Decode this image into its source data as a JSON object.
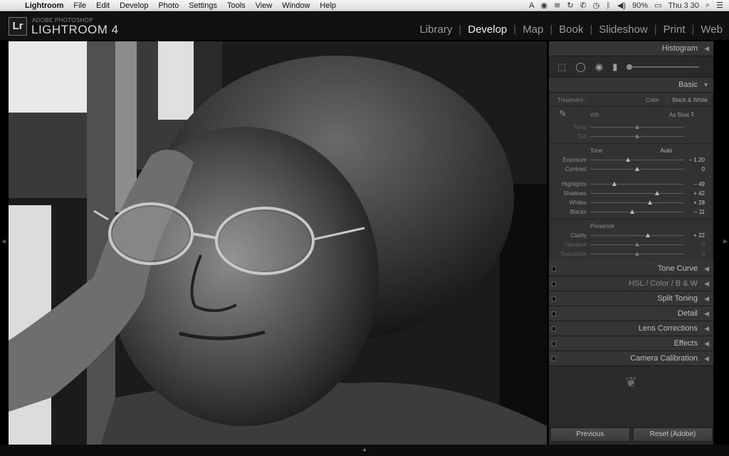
{
  "menubar": {
    "app": "Lightroom",
    "items": [
      "File",
      "Edit",
      "Develop",
      "Photo",
      "Settings",
      "Tools",
      "View",
      "Window",
      "Help"
    ],
    "battery": "90%",
    "clock": "Thu 3 30"
  },
  "identity": {
    "logo": "Lr",
    "line1": "ADOBE PHOTOSHOP",
    "line2": "LIGHTROOM 4"
  },
  "modules": [
    "Library",
    "Develop",
    "Map",
    "Book",
    "Slideshow",
    "Print",
    "Web"
  ],
  "active_module": "Develop",
  "panels": {
    "histogram": "Histogram",
    "basic": "Basic",
    "treatment_label": "Treatment :",
    "treatment_color": "Color",
    "treatment_bw": "Black & White",
    "wb_label": "WB :",
    "wb_value": "As Shot",
    "tone_label": "Tone",
    "auto_label": "Auto",
    "presence_label": "Presence",
    "sliders": {
      "temp": {
        "label": "Temp",
        "value": "",
        "pos": 0.5
      },
      "tint": {
        "label": "Tint",
        "value": "",
        "pos": 0.5
      },
      "exposure": {
        "label": "Exposure",
        "value": "– 1.20",
        "pos": 0.4
      },
      "contrast": {
        "label": "Contrast",
        "value": "0",
        "pos": 0.5
      },
      "highlights": {
        "label": "Highlights",
        "value": "– 49",
        "pos": 0.255
      },
      "shadows": {
        "label": "Shadows",
        "value": "+ 42",
        "pos": 0.71
      },
      "whites": {
        "label": "Whites",
        "value": "+ 28",
        "pos": 0.64
      },
      "blacks": {
        "label": "Blacks",
        "value": "– 11",
        "pos": 0.445
      },
      "clarity": {
        "label": "Clarity",
        "value": "+ 22",
        "pos": 0.61
      },
      "vibrance": {
        "label": "Vibrance",
        "value": "0",
        "pos": 0.5
      },
      "saturation": {
        "label": "Saturation",
        "value": "0",
        "pos": 0.5
      }
    },
    "collapsed": [
      "Tone Curve",
      "HSL / Color / B & W",
      "Split Toning",
      "Detail",
      "Lens Corrections",
      "Effects",
      "Camera Calibration"
    ],
    "previous_button": "Previous",
    "reset_button": "Reset (Adobe)"
  }
}
